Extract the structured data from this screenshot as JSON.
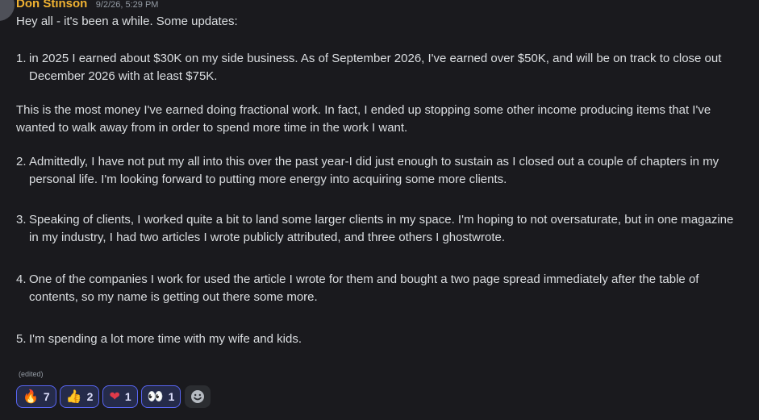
{
  "message": {
    "author": "Don Stinson",
    "timestamp": "9/2/26, 5:29 PM",
    "intro": "Hey all - it's been a while. Some updates:",
    "points": [
      {
        "num": "1.",
        "text": "in 2025 I earned about $30K on my side business. As of September 2026, I've earned over $50K, and will be on track to close out December 2026 with at least $75K."
      },
      {
        "num": "2.",
        "text": "Admittedly, I have not put my all into this over the past year-I did just enough to sustain as I closed out a couple of chapters in my personal life. I'm looking forward to putting more energy into acquiring some more clients."
      },
      {
        "num": "3.",
        "text": "Speaking of clients, I worked quite a bit to land some larger clients in my space. I'm hoping to not oversaturate, but in one magazine in my industry, I had two articles I wrote publicly attributed, and three others I ghostwrote."
      },
      {
        "num": "4.",
        "text": "One of the companies I work for used the article I wrote for them and bought a two page spread immediately after the table of contents, so my name is getting out there some more."
      },
      {
        "num": "5.",
        "text": "I'm spending a lot more time with my wife and kids."
      }
    ],
    "paragraph_after_1": "This is the most money I've earned doing fractional work. In fact, I ended up stopping some other income producing items that I've wanted to walk away from in order to spend more time in the work I want.",
    "edited_label": "(edited)"
  },
  "reactions": [
    {
      "emoji": "🔥",
      "icon": "fire-emoji",
      "count": "7"
    },
    {
      "emoji": "👍",
      "icon": "thumbs-up-emoji",
      "count": "2"
    },
    {
      "emoji": "❤",
      "icon": "red-heart-emoji",
      "count": "1"
    },
    {
      "emoji": "👀",
      "icon": "eyes-emoji",
      "count": "1"
    }
  ],
  "add_reaction_icon": "smiley-add-reaction-icon",
  "colors": {
    "background": "#1a1a1e",
    "author": "#f0b232",
    "reaction_border": "#5865f2",
    "reaction_bg": "#252b4a"
  }
}
